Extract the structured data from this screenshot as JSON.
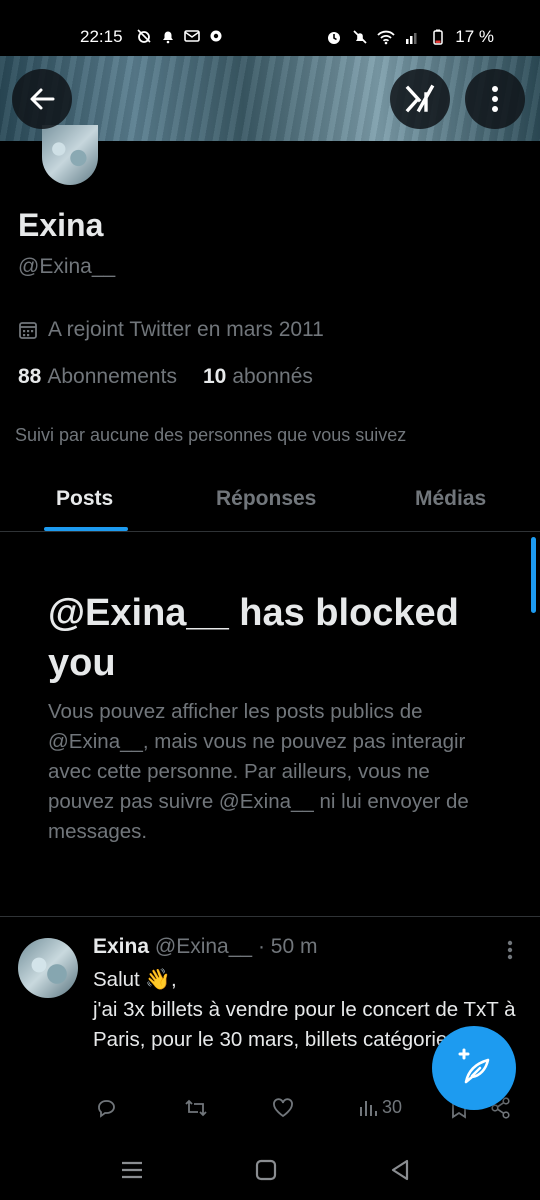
{
  "status_bar": {
    "time": "22:15",
    "battery": "17 %"
  },
  "profile": {
    "name": "Exina",
    "handle": "@Exina__",
    "joined": "A rejoint Twitter en mars 2011",
    "following_count": "88",
    "following_label": "Abonnements",
    "followers_count": "10",
    "followers_label": "abonnés",
    "followed_by": "Suivi par aucune des personnes que vous suivez"
  },
  "tabs": [
    {
      "label": "Posts",
      "active": true
    },
    {
      "label": "Réponses",
      "active": false
    },
    {
      "label": "Médias",
      "active": false
    }
  ],
  "blocked": {
    "title": "@Exina__ has blocked you",
    "body": "Vous pouvez afficher les posts publics de @Exina__, mais vous ne pouvez pas interagir avec cette personne. Par ailleurs, vous ne pouvez pas suivre @Exina__ ni lui envoyer de messages."
  },
  "tweet": {
    "name": "Exina",
    "handle": "@Exina__",
    "time": "· 50 m",
    "text": "Salut 👋,\n j'ai 3x billets à vendre pour le concert de TxT à Paris, pour le 30 mars, billets catégorie 3",
    "views": "30"
  },
  "icons": [
    "back-arrow-icon",
    "grok-icon",
    "more-vertical-icon",
    "calendar-icon",
    "reply-icon",
    "retweet-icon",
    "like-icon",
    "views-icon",
    "bookmark-icon",
    "share-icon",
    "compose-icon"
  ],
  "colors": {
    "accent": "#1d9bf0",
    "text": "#e7e9ea",
    "muted": "#71767b",
    "border": "#2f3336"
  }
}
